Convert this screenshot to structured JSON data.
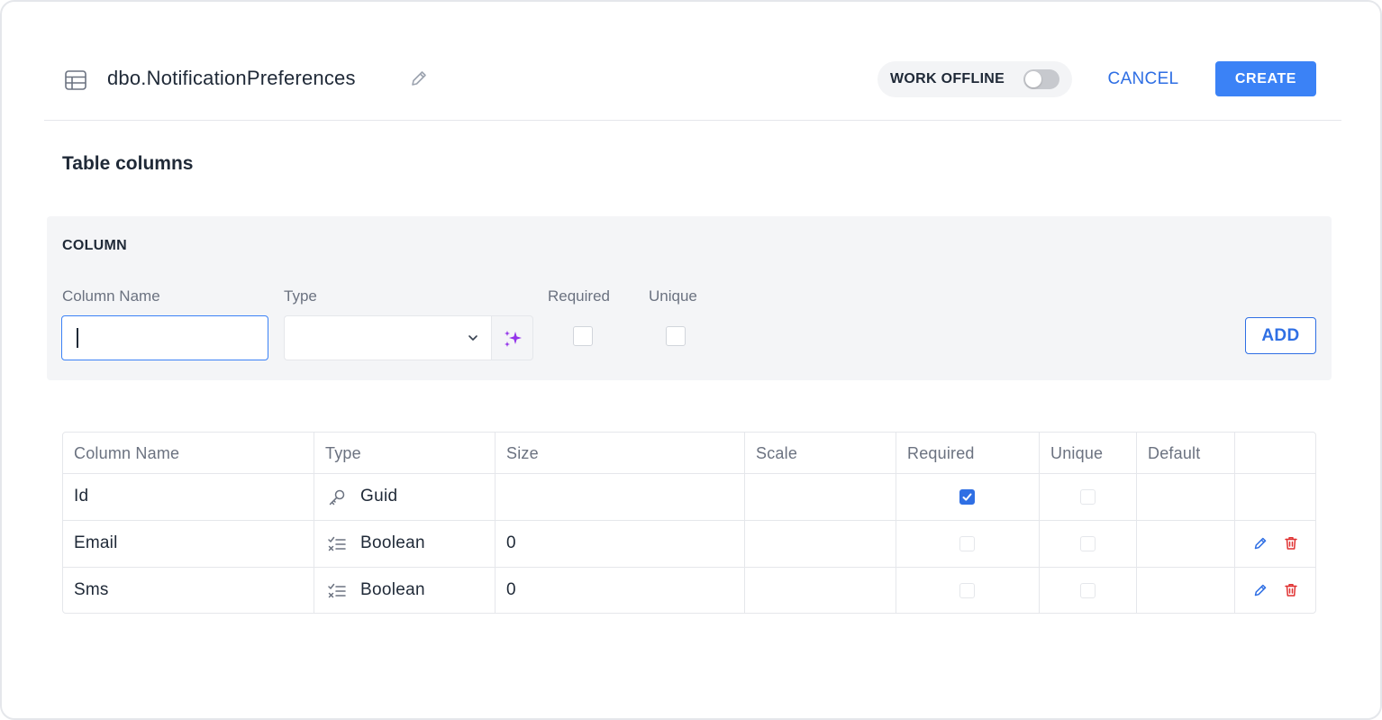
{
  "header": {
    "title": "dbo.NotificationPreferences",
    "table_icon": "table-grid-icon",
    "edit_icon": "pencil-icon",
    "work_offline_label": "WORK OFFLINE",
    "work_offline_enabled": false,
    "cancel_label": "CANCEL",
    "create_label": "CREATE"
  },
  "section_title": "Table columns",
  "column_form": {
    "heading": "COLUMN",
    "name_label": "Column Name",
    "name_value": "",
    "type_label": "Type",
    "type_value": "",
    "ai_icon": "sparkles-icon",
    "required_label": "Required",
    "required_checked": false,
    "unique_label": "Unique",
    "unique_checked": false,
    "add_label": "ADD"
  },
  "table": {
    "headers": [
      "Column Name",
      "Type",
      "Size",
      "Scale",
      "Required",
      "Unique",
      "Default",
      ""
    ],
    "rows": [
      {
        "name": "Id",
        "type": "Guid",
        "type_icon": "key-icon",
        "size": "",
        "scale": "",
        "required": true,
        "unique": false,
        "default": "",
        "actions": false
      },
      {
        "name": "Email",
        "type": "Boolean",
        "type_icon": "checklist-icon",
        "size": "0",
        "scale": "",
        "required": false,
        "unique": false,
        "default": "",
        "actions": true
      },
      {
        "name": "Sms",
        "type": "Boolean",
        "type_icon": "checklist-icon",
        "size": "0",
        "scale": "",
        "required": false,
        "unique": false,
        "default": "",
        "actions": true
      }
    ]
  },
  "colors": {
    "accent": "#2f6fe4",
    "create_bg": "#3b82f6",
    "delete": "#e03131",
    "ai_purple": "#9333ea"
  }
}
